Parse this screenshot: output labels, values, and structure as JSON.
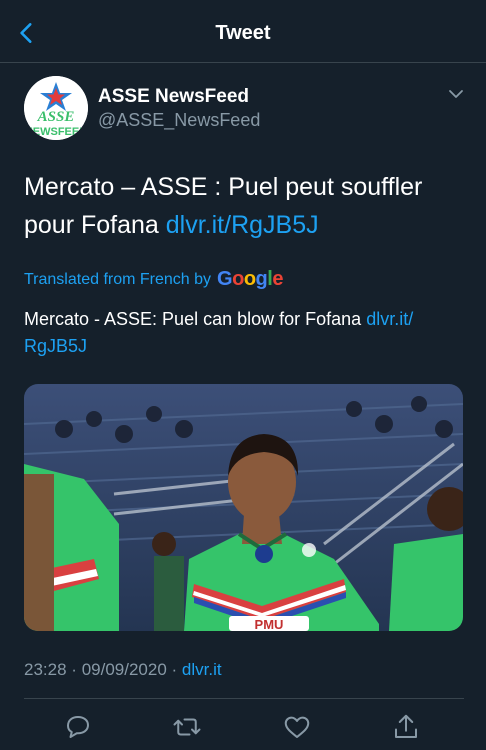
{
  "header": {
    "title": "Tweet",
    "back_icon": "chevron-left-icon"
  },
  "author": {
    "name": "ASSE NewsFeed",
    "handle": "@ASSE_NewsFeed",
    "avatar_text": "NEWSFEED"
  },
  "tweet": {
    "text": "Mercato – ASSE : Puel peut souffler pour Fofana",
    "link": "dlvr.it/RgJB5J"
  },
  "translation": {
    "label": "Translated from French by",
    "provider": "Google",
    "text": "Mercato - ASSE: Puel can blow for Fofana",
    "link_part1": "dlvr.it/",
    "link_part2": "RgJB5J"
  },
  "meta": {
    "time": "23:28",
    "date": "09/09/2020",
    "separator": "·",
    "source": "dlvr.it"
  },
  "jersey_sponsor": "PMU",
  "colors": {
    "background": "#15202b",
    "accent": "#1da1f2",
    "secondary_text": "#8899a6",
    "divider": "#38444d",
    "jersey_green": "#35c46a"
  },
  "actions": [
    "reply-icon",
    "retweet-icon",
    "like-icon",
    "share-icon"
  ]
}
